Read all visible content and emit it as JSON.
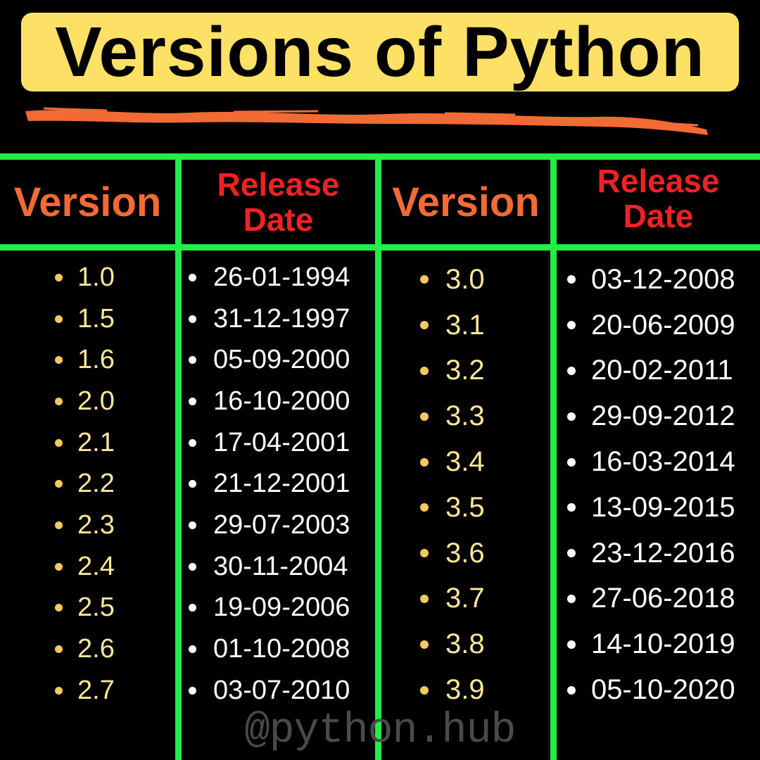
{
  "title": "Versions of Python",
  "headers": {
    "version": "Version",
    "release_line1": "Release",
    "release_line2": "Date"
  },
  "left_table": {
    "versions": [
      "1.0",
      "1.5",
      "1.6",
      "2.0",
      "2.1",
      "2.2",
      "2.3",
      "2.4",
      "2.5",
      "2.6",
      "2.7"
    ],
    "dates": [
      "26-01-1994",
      "31-12-1997",
      "05-09-2000",
      "16-10-2000",
      "17-04-2001",
      "21-12-2001",
      "29-07-2003",
      "30-11-2004",
      "19-09-2006",
      "01-10-2008",
      "03-07-2010"
    ]
  },
  "right_table": {
    "versions": [
      "3.0",
      "3.1",
      "3.2",
      "3.3",
      "3.4",
      "3.5",
      "3.6",
      "3.7",
      "3.8",
      "3.9"
    ],
    "dates": [
      "03-12-2008",
      "20-06-2009",
      "20-02-2011",
      "29-09-2012",
      "16-03-2014",
      "13-09-2015",
      "23-12-2016",
      "27-06-2018",
      "14-10-2019",
      "05-10-2020"
    ]
  },
  "watermark": "@python.hub",
  "colors": {
    "background": "#000000",
    "title_box": "#fde166",
    "grid_lines": "#22ee44",
    "version_header": "#f26b35",
    "date_header": "#ee2222",
    "version_text": "#fde79a",
    "date_text": "#ffffff",
    "underline_stroke": "#f26b35"
  }
}
